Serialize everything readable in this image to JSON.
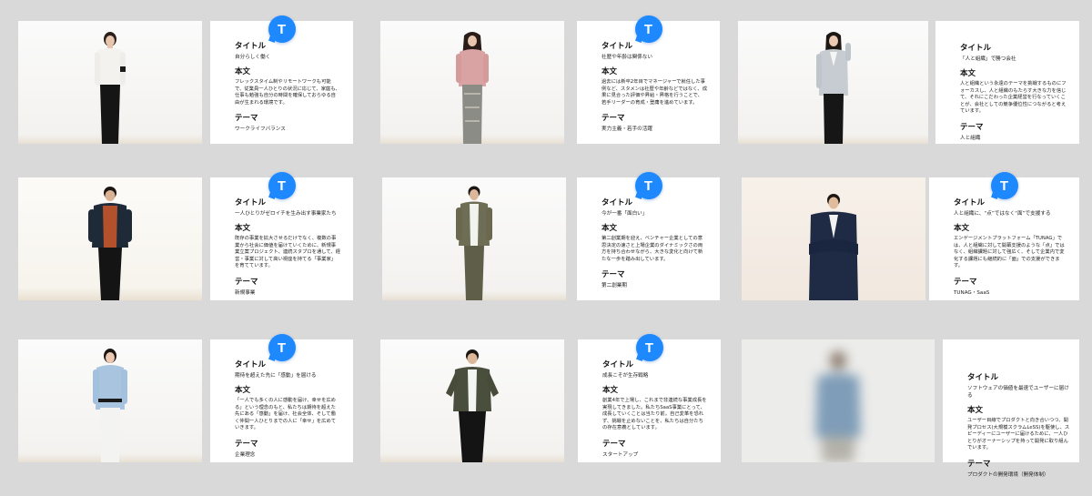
{
  "labels": {
    "title": "タイトル",
    "body": "本文",
    "theme": "テーマ",
    "badge": "T"
  },
  "cards": [
    {
      "title": "自分らしく働く",
      "body": "フレックスタイム制やリモートワークも可能で、従業員一人ひとりの状況に応じて、家庭も、仕事も勉強も自分の時間を確保しておらゆる自由が生まれる環境です。",
      "theme": "ワークライフバランス"
    },
    {
      "title": "社歴や年齢は関係ない",
      "body": "過去には新卒2年目でマネージャーで就任した事例など、スタメンは社歴や年齢などではなく、成果に見合った評価や昇給・昇格を行うことで、若手リーダーの育成・登庸を進めています。",
      "theme": "実力主義・若手の活躍"
    },
    {
      "title": "「人と組織」で勝つ会社",
      "body": "人と組織という永遠のテーマを挑戦するものにフォーカスし、人と組織のもたらす大きな力を信じて、それにこだわった企業経営を行なっていくことが、会社としての競争優位性につながると考えています。",
      "theme": "人と組織"
    },
    {
      "title": "一人ひとりがゼロイチを生み出す事業家たち",
      "body": "既存の事業を拡大させるだけでなく、複数の事業から社会に価値を届けていくために、新規事業立案プロジェクト、連続スタプロを通して、経営・事業に対して高い視座を持てる「事業家」を育てています。",
      "theme": "新規事業"
    },
    {
      "title": "今が一番「面白い」",
      "body": "第二創業期を迎え、ベンチャー企業としての意思決定の速さと上場企業のダイナミックさの両方を持ち合わせながら、大きな変化と向けて新たな一歩を踏み出しています。",
      "theme": "第二創業期"
    },
    {
      "title": "人と組織に、“点”ではなく“面”で支援する",
      "body": "エンゲージメントプラットフォーム「TUNAG」では、人と組織に対して開幕支援のような「点」ではなく、組織課題に対して強広く、そして企業内で変化する課題にも継続的に「面」での支援ができます。",
      "theme": "TUNAG・SaaS"
    },
    {
      "title": "期待を超えた先に「感動」を届ける",
      "body": "「一人でも多くの人に感動を届け、幸せを広める」という理念のもと、私たちは期待を超えた先にある「感動」を届け、社会全体、そして働く仲間一人ひとりまでの人に「幸せ」を広めていきます。",
      "theme": "企業理念"
    },
    {
      "title": "成長こそが生存戦略",
      "body": "創業4年で上場し、これまで非連続な事業成長を実現してきました。私たちSaaS事業にとって、成長していくことは当たり前。自己変革を恐れず、挑戦を止めないことを、私たちは自分たちの存在意義としています。",
      "theme": "スタートアップ"
    },
    {
      "title": "ソフトウェアの価値を最速でユーザーに届ける",
      "body": "ユーザー目線でプロダクトと向き合いつつ、開発プロセス(大規模スクラムLeSS)を駆使し、スピーディーにユーザーに届けるために、一人ひとりがオーナーシップを持って開発に取り組んでいます。",
      "theme": "プロダクトの開発環境（開発体制）"
    }
  ]
}
